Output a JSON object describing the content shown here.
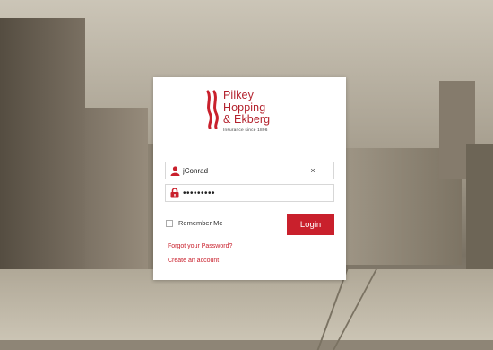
{
  "brand": {
    "name_lines": [
      "Pilkey",
      "Hopping",
      "& Ekberg"
    ],
    "tagline": "Insurance since 1896",
    "color": "#b3222d"
  },
  "login_form": {
    "username_value": "jConrad",
    "username_icon": "user-icon",
    "password_value": "•••••••••",
    "password_icon": "lock-icon",
    "clear_label": "×",
    "remember_label": "Remember Me",
    "remember_checked": false,
    "login_label": "Login",
    "forgot_link": "Forgot your Password?",
    "create_link": "Create an account",
    "accent_color": "#c9202c"
  }
}
